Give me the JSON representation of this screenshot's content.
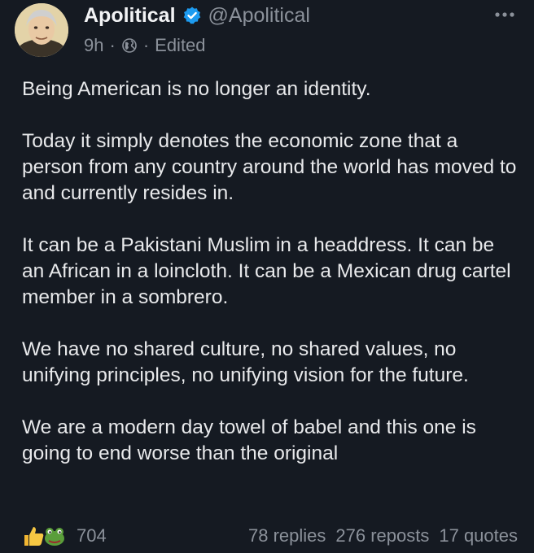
{
  "post": {
    "author": {
      "display_name": "Apolitical",
      "handle": "@Apolitical",
      "verified": true
    },
    "meta": {
      "time": "9h",
      "separator": "·",
      "visibility_icon": "globe-icon",
      "edited": "Edited"
    },
    "paragraphs": [
      "Being American is no longer an identity.",
      "Today it simply denotes the economic zone that a person from any country around the world has moved to and currently resides in.",
      "It can be a Pakistani Muslim in a headdress. It can be an African in a loincloth. It can be a Mexican drug cartel member in a sombrero.",
      "We have no shared culture, no shared values, no unifying principles, no unifying vision for the future.",
      "We are a modern day towel of babel and this one is going to end worse than the original"
    ],
    "footer": {
      "reaction_icons": [
        "thumbs-up-icon",
        "frog-icon"
      ],
      "reaction_count": "704",
      "replies": "78 replies",
      "reposts": "276 reposts",
      "quotes": "17 quotes"
    }
  },
  "colors": {
    "background": "#151a22",
    "text": "#e8e9eb",
    "muted": "#8b919a",
    "verified": "#1d9bf0"
  }
}
